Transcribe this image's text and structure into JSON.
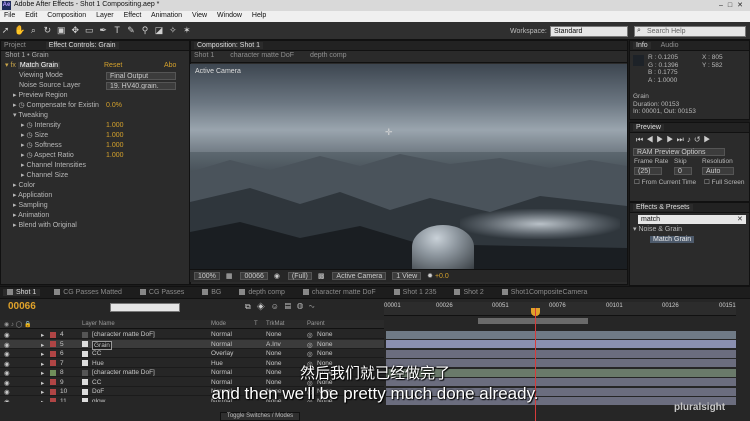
{
  "window": {
    "title": "Adobe After Effects - Shot 1 Compositing.aep *",
    "app_icon": "Ae"
  },
  "menu": [
    "File",
    "Edit",
    "Composition",
    "Layer",
    "Effect",
    "Animation",
    "View",
    "Window",
    "Help"
  ],
  "toolbar": {
    "icons": [
      "selection-tool",
      "hand-tool",
      "zoom-tool",
      "rotate-tool",
      "camera-tool",
      "pan-behind-tool",
      "rectangle-tool",
      "pen-tool",
      "type-tool",
      "brush-tool",
      "clone-stamp-tool",
      "eraser-tool",
      "roto-brush-tool",
      "puppet-tool"
    ],
    "workspace_label": "Workspace:",
    "workspace_value": "Standard",
    "search_placeholder": "Search Help"
  },
  "left_panel": {
    "tab_project": "Project",
    "tab_effect_controls": "Effect Controls: Grain",
    "breadcrumb": "Shot 1 • Grain",
    "effect": {
      "name": "Match Grain",
      "reset": "Reset",
      "about": "Abo",
      "properties": [
        {
          "label": "Viewing Mode",
          "value": "Final Output"
        },
        {
          "label": "Noise Source Layer",
          "value": "19. HV40.grain."
        },
        {
          "label": "Preview Region",
          "value": ""
        },
        {
          "label": "Compensate for Existin",
          "value": "0.0%"
        },
        {
          "label": "Tweaking",
          "value": ""
        },
        {
          "label": "Intensity",
          "value": "1.000"
        },
        {
          "label": "Size",
          "value": "1.000"
        },
        {
          "label": "Softness",
          "value": "1.000"
        },
        {
          "label": "Aspect Ratio",
          "value": "1.000"
        },
        {
          "label": "Channel Intensities",
          "value": ""
        },
        {
          "label": "Channel Size",
          "value": ""
        },
        {
          "label": "Color",
          "value": ""
        },
        {
          "label": "Application",
          "value": ""
        },
        {
          "label": "Sampling",
          "value": ""
        },
        {
          "label": "Animation",
          "value": ""
        },
        {
          "label": "Blend with Original",
          "value": ""
        }
      ]
    }
  },
  "composition": {
    "tab": "Composition: Shot 1",
    "breadcrumbs": [
      "Shot 1",
      "character matte DoF",
      "depth comp"
    ],
    "camera_label": "Active Camera",
    "footer": {
      "zoom": "100%",
      "timecode": "00066",
      "resolution": "(Full)",
      "camera": "Active Camera",
      "views": "1 View",
      "exposure": "+0.0"
    }
  },
  "info": {
    "tab_info": "Info",
    "tab_audio": "Audio",
    "r": "R : 0.1205",
    "g": "G : 0.1396",
    "b": "B : 0.1775",
    "a": "A : 1.0000",
    "x": "X : 805",
    "y": "Y : 582",
    "layer": "Grain",
    "duration": "Duration: 00153",
    "in_out": "In: 00001, Out: 00153"
  },
  "preview": {
    "tab": "Preview",
    "ram_options": "RAM Preview Options",
    "frame_rate_label": "Frame Rate",
    "skip_label": "Skip",
    "resolution_label": "Resolution",
    "frame_rate": "(25)",
    "skip": "0",
    "resolution": "Auto",
    "from_current": "From Current Time",
    "full_screen": "Full Screen"
  },
  "effects_presets": {
    "tab": "Effects & Presets",
    "search": "match",
    "category": "Noise & Grain",
    "item": "Match Grain"
  },
  "timeline": {
    "tabs": [
      "Shot 1",
      "CG Passes Matted",
      "CG Passes",
      "BG",
      "depth comp",
      "character matte DoF",
      "Shot 1 235",
      "Shot 2",
      "Shot1CompositeCamera"
    ],
    "timecode": "00066",
    "ruler": [
      "00001",
      "00026",
      "00051",
      "00076",
      "00101",
      "00126",
      "00151"
    ],
    "header": {
      "layer_name": "Layer Name",
      "mode": "Mode",
      "t": "T",
      "trkmat": "TrkMat",
      "parent": "Parent"
    },
    "layers": [
      {
        "num": "4",
        "name": "[character matte DoF]",
        "mode": "Normal",
        "trkmat": "None",
        "parent": "None",
        "color": "#b04545",
        "bar": "#6f7a86"
      },
      {
        "num": "5",
        "name": "Grain",
        "mode": "Normal",
        "trkmat": "A.Inv",
        "parent": "None",
        "color": "#b04545",
        "bar": "#8a8fb0"
      },
      {
        "num": "6",
        "name": "CC",
        "mode": "Overlay",
        "trkmat": "None",
        "parent": "None",
        "color": "#b04545",
        "bar": "#6b6d7e"
      },
      {
        "num": "7",
        "name": "Hue",
        "mode": "Hue",
        "trkmat": "None",
        "parent": "None",
        "color": "#b04545",
        "bar": "#6b6d7e"
      },
      {
        "num": "8",
        "name": "[character matte DoF]",
        "mode": "Normal",
        "trkmat": "None",
        "parent": "None",
        "color": "#6f8e5a",
        "bar": "#6a7a6a"
      },
      {
        "num": "9",
        "name": "CC",
        "mode": "Normal",
        "trkmat": "None",
        "parent": "None",
        "color": "#b04545",
        "bar": "#6b6d7e"
      },
      {
        "num": "10",
        "name": "DoF",
        "mode": "Normal",
        "trkmat": "None",
        "parent": "None",
        "color": "#b04545",
        "bar": "#6b6d7e"
      },
      {
        "num": "11",
        "name": "glow",
        "mode": "Normal",
        "trkmat": "None",
        "parent": "None",
        "color": "#b04545",
        "bar": "#6b6d7e"
      }
    ],
    "toggle": "Toggle Switches / Modes"
  },
  "subtitles": {
    "zh": "然后我们就已经做完了",
    "en": "and then we'll be pretty much done already."
  },
  "watermark": "pluralsight"
}
